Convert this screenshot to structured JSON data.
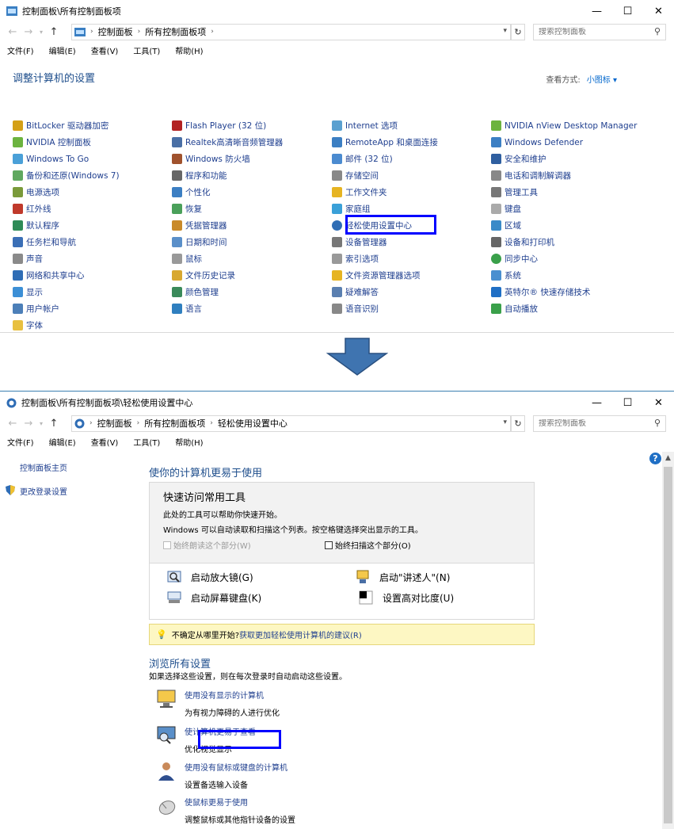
{
  "win1": {
    "title": "控制面板\\所有控制面板项",
    "crumbs": [
      "控制面板",
      "所有控制面板项"
    ],
    "search_placeholder": "搜索控制面板",
    "menu": [
      "文件(F)",
      "编辑(E)",
      "查看(V)",
      "工具(T)",
      "帮助(H)"
    ],
    "heading": "调整计算机的设置",
    "view_label": "查看方式:",
    "view_value": "小图标 ▾",
    "col1": [
      "BitLocker 驱动器加密",
      "NVIDIA 控制面板",
      "Windows To Go",
      "备份和还原(Windows 7)",
      "电源选项",
      "红外线",
      "默认程序",
      "任务栏和导航",
      "声音",
      "网络和共享中心",
      "显示",
      "用户帐户",
      "字体"
    ],
    "col2": [
      "Flash Player (32 位)",
      "Realtek高清晰音频管理器",
      "Windows 防火墙",
      "程序和功能",
      "个性化",
      "恢复",
      "凭据管理器",
      "日期和时间",
      "鼠标",
      "文件历史记录",
      "颜色管理",
      "语言"
    ],
    "col3": [
      "Internet 选项",
      "RemoteApp 和桌面连接",
      "邮件 (32 位)",
      "存储空间",
      "工作文件夹",
      "家庭组",
      "轻松使用设置中心",
      "设备管理器",
      "索引选项",
      "文件资源管理器选项",
      "疑难解答",
      "语音识别"
    ],
    "col4": [
      "NVIDIA nView Desktop Manager",
      "Windows Defender",
      "安全和维护",
      "电话和调制解调器",
      "管理工具",
      "键盘",
      "区域",
      "设备和打印机",
      "同步中心",
      "系统",
      "英特尔® 快速存储技术",
      "自动播放"
    ]
  },
  "win2": {
    "title": "控制面板\\所有控制面板项\\轻松使用设置中心",
    "crumbs": [
      "控制面板",
      "所有控制面板项",
      "轻松使用设置中心"
    ],
    "search_placeholder": "搜索控制面板",
    "menu": [
      "文件(F)",
      "编辑(E)",
      "查看(V)",
      "工具(T)",
      "帮助(H)"
    ],
    "side_home": "控制面板主页",
    "side_login": "更改登录设置",
    "main_title": "使你的计算机更易于使用",
    "quick_head": "快速访问常用工具",
    "quick_line1": "此处的工具可以帮助你快速开始。",
    "quick_line2": "Windows 可以自动读取和扫描这个列表。按空格键选择突出显示的工具。",
    "chk_read": "始终朗读这个部分(W)",
    "chk_scan": "始终扫描这个部分(O)",
    "tools": [
      "启动放大镜(G)",
      "启动\"讲述人\"(N)",
      "启动屏幕键盘(K)",
      "设置高对比度(U)"
    ],
    "tip_text": "不确定从哪里开始?",
    "tip_link": "获取更加轻松使用计算机的建议(R)",
    "browse_title": "浏览所有设置",
    "browse_sub": "如果选择这些设置，则在每次登录时自动启动这些设置。",
    "settings": [
      {
        "link": "使用没有显示的计算机",
        "desc": "为有视力障碍的人进行优化"
      },
      {
        "link": "使计算机更易于查看",
        "desc": "优化视觉显示"
      },
      {
        "link": "使用没有鼠标或键盘的计算机",
        "desc": "设置备选输入设备"
      },
      {
        "link": "使鼠标更易于使用",
        "desc": "调整鼠标或其他指针设备的设置"
      }
    ]
  },
  "colors": {
    "accent": "#1f3f8f",
    "highlight": "#0000ff",
    "arrow": "#3f74b0",
    "tip_bg": "#fdf7c3"
  }
}
